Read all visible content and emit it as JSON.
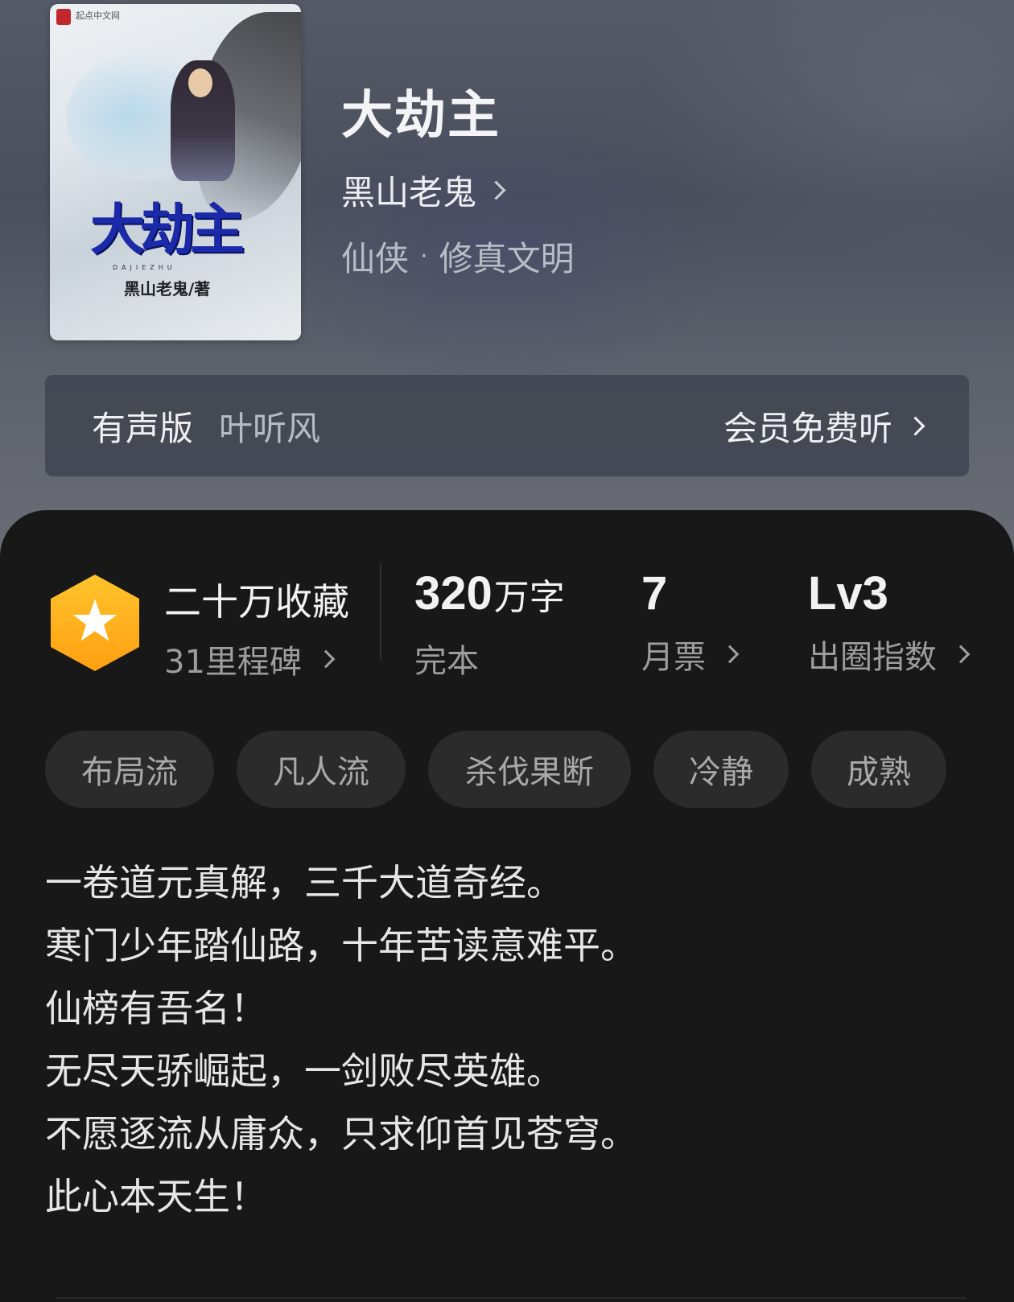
{
  "book": {
    "cover": {
      "publisher": "起点中文网",
      "title": "大劫主",
      "pinyin": "DAJIEZHU",
      "author_credit": "黑山老鬼/著"
    },
    "title": "大劫主",
    "author": "黑山老鬼",
    "genre": "仙侠",
    "genre_separator": "·",
    "subgenre": "修真文明"
  },
  "audio": {
    "label": "有声版",
    "narrator": "叶听风",
    "cta": "会员免费听"
  },
  "stats": {
    "collections": "二十万收藏",
    "milestones": "31里程碑",
    "word_count_number": "320",
    "word_count_unit": "万字",
    "status": "完本",
    "monthly_votes": "7",
    "monthly_votes_label": "月票",
    "level": "Lv3",
    "level_label": "出圈指数"
  },
  "tags": [
    "布局流",
    "凡人流",
    "杀伐果断",
    "冷静",
    "成熟"
  ],
  "intro": [
    "一卷道元真解，三千大道奇经。",
    "寒门少年踏仙路，十年苦读意难平。",
    "仙榜有吾名！",
    "无尽天骄崛起，一剑败尽英雄。",
    "不愿逐流从庸众，只求仰首见苍穹。",
    "此心本天生！"
  ],
  "colors": {
    "accent_badge": "#ffb020",
    "card_bg": "#181818",
    "tag_bg": "#2b2b2b",
    "cover_title": "#1b2aa8"
  }
}
